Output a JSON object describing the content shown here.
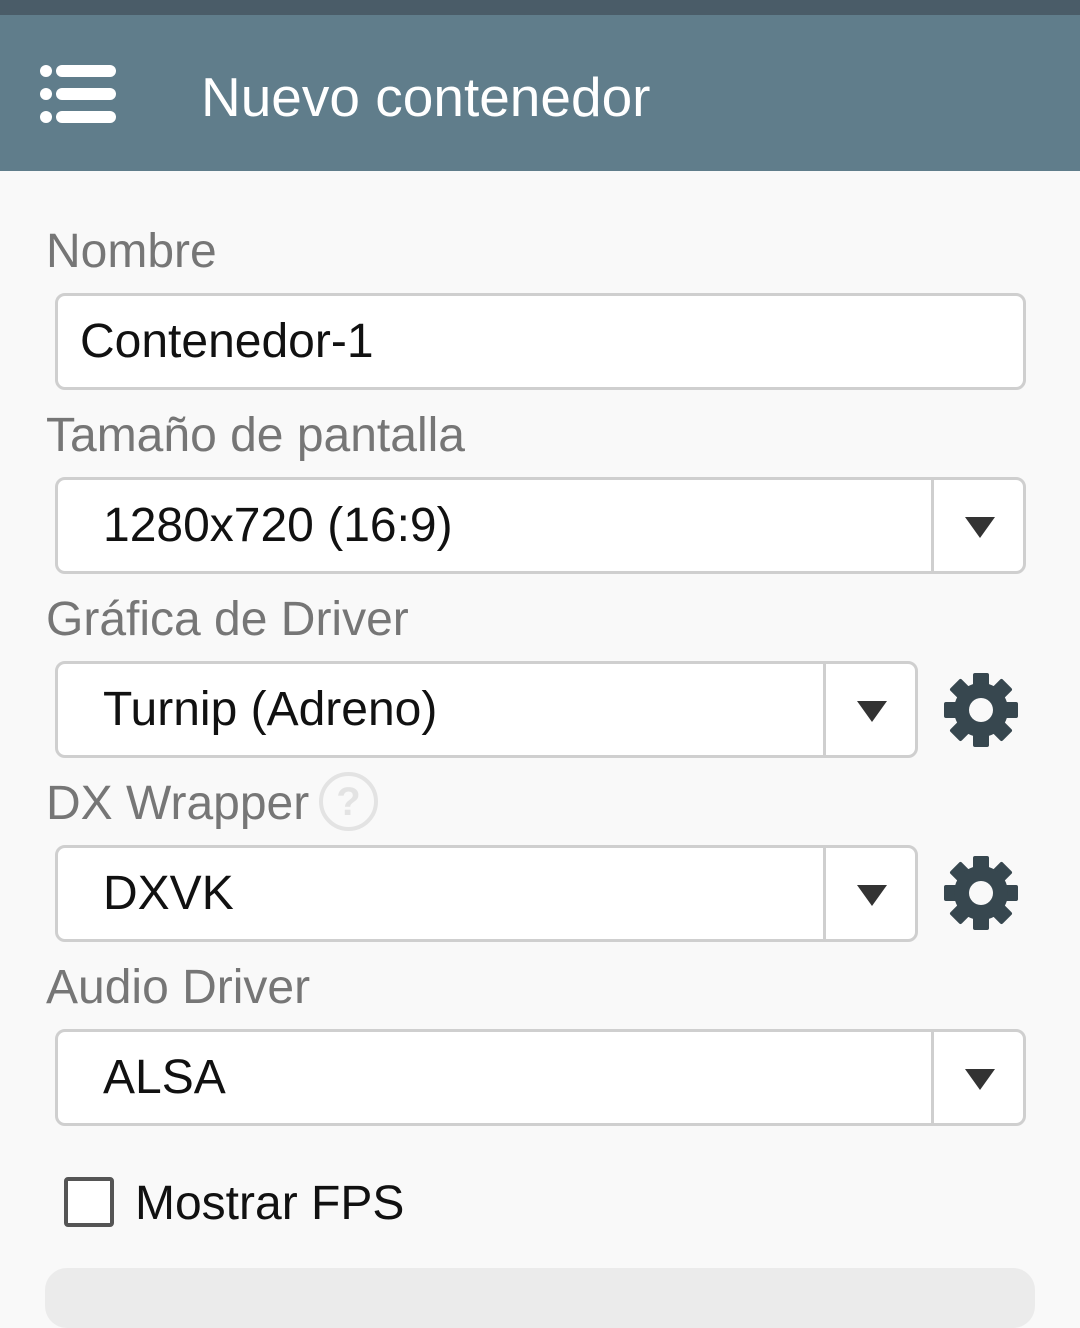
{
  "app_bar": {
    "title": "Nuevo contenedor",
    "menu_icon": "list-menu-icon",
    "background": "#607d8b",
    "status_bar_color": "#4a5c68"
  },
  "form": {
    "name": {
      "label": "Nombre",
      "value": "Contenedor-1"
    },
    "screen_size": {
      "label": "Tamaño de pantalla",
      "selected": "1280x720 (16:9)"
    },
    "graphics_driver": {
      "label": "Gráfica de Driver",
      "selected": "Turnip (Adreno)",
      "settings_icon": "gear-icon"
    },
    "dx_wrapper": {
      "label": "DX Wrapper",
      "selected": "DXVK",
      "help_icon": "help-icon",
      "settings_icon": "gear-icon"
    },
    "audio_driver": {
      "label": "Audio Driver",
      "selected": "ALSA"
    },
    "show_fps": {
      "label": "Mostrar FPS",
      "checked": false
    }
  }
}
